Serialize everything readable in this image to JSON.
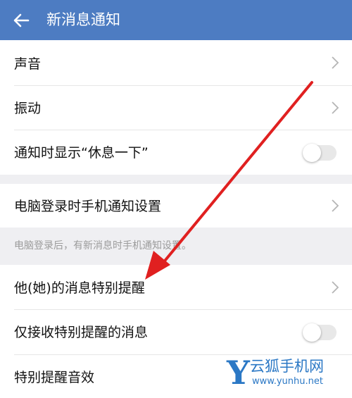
{
  "header": {
    "title": "新消息通知",
    "back_icon": "arrow-left-icon"
  },
  "settings": {
    "sound": "声音",
    "vibration": "振动",
    "show_rest": "通知时显示“休息一下”",
    "show_rest_enabled": false,
    "pc_login": "电脑登录时手机通知设置",
    "pc_login_hint": "电脑登录后，有新消息时手机通知设置。",
    "special_remind": "他(她)的消息特别提醒",
    "only_special": "仅接收特别提醒的消息",
    "only_special_enabled": false,
    "special_sound": "特别提醒音效"
  },
  "watermark": {
    "brand": "云狐手机网",
    "letter": "Y",
    "url": "www.yunhu.net"
  },
  "colors": {
    "header_bg": "#4d7cc2",
    "arrow": "#e02020",
    "watermark": "#2b78c5",
    "section_gap": "#efeff2"
  }
}
